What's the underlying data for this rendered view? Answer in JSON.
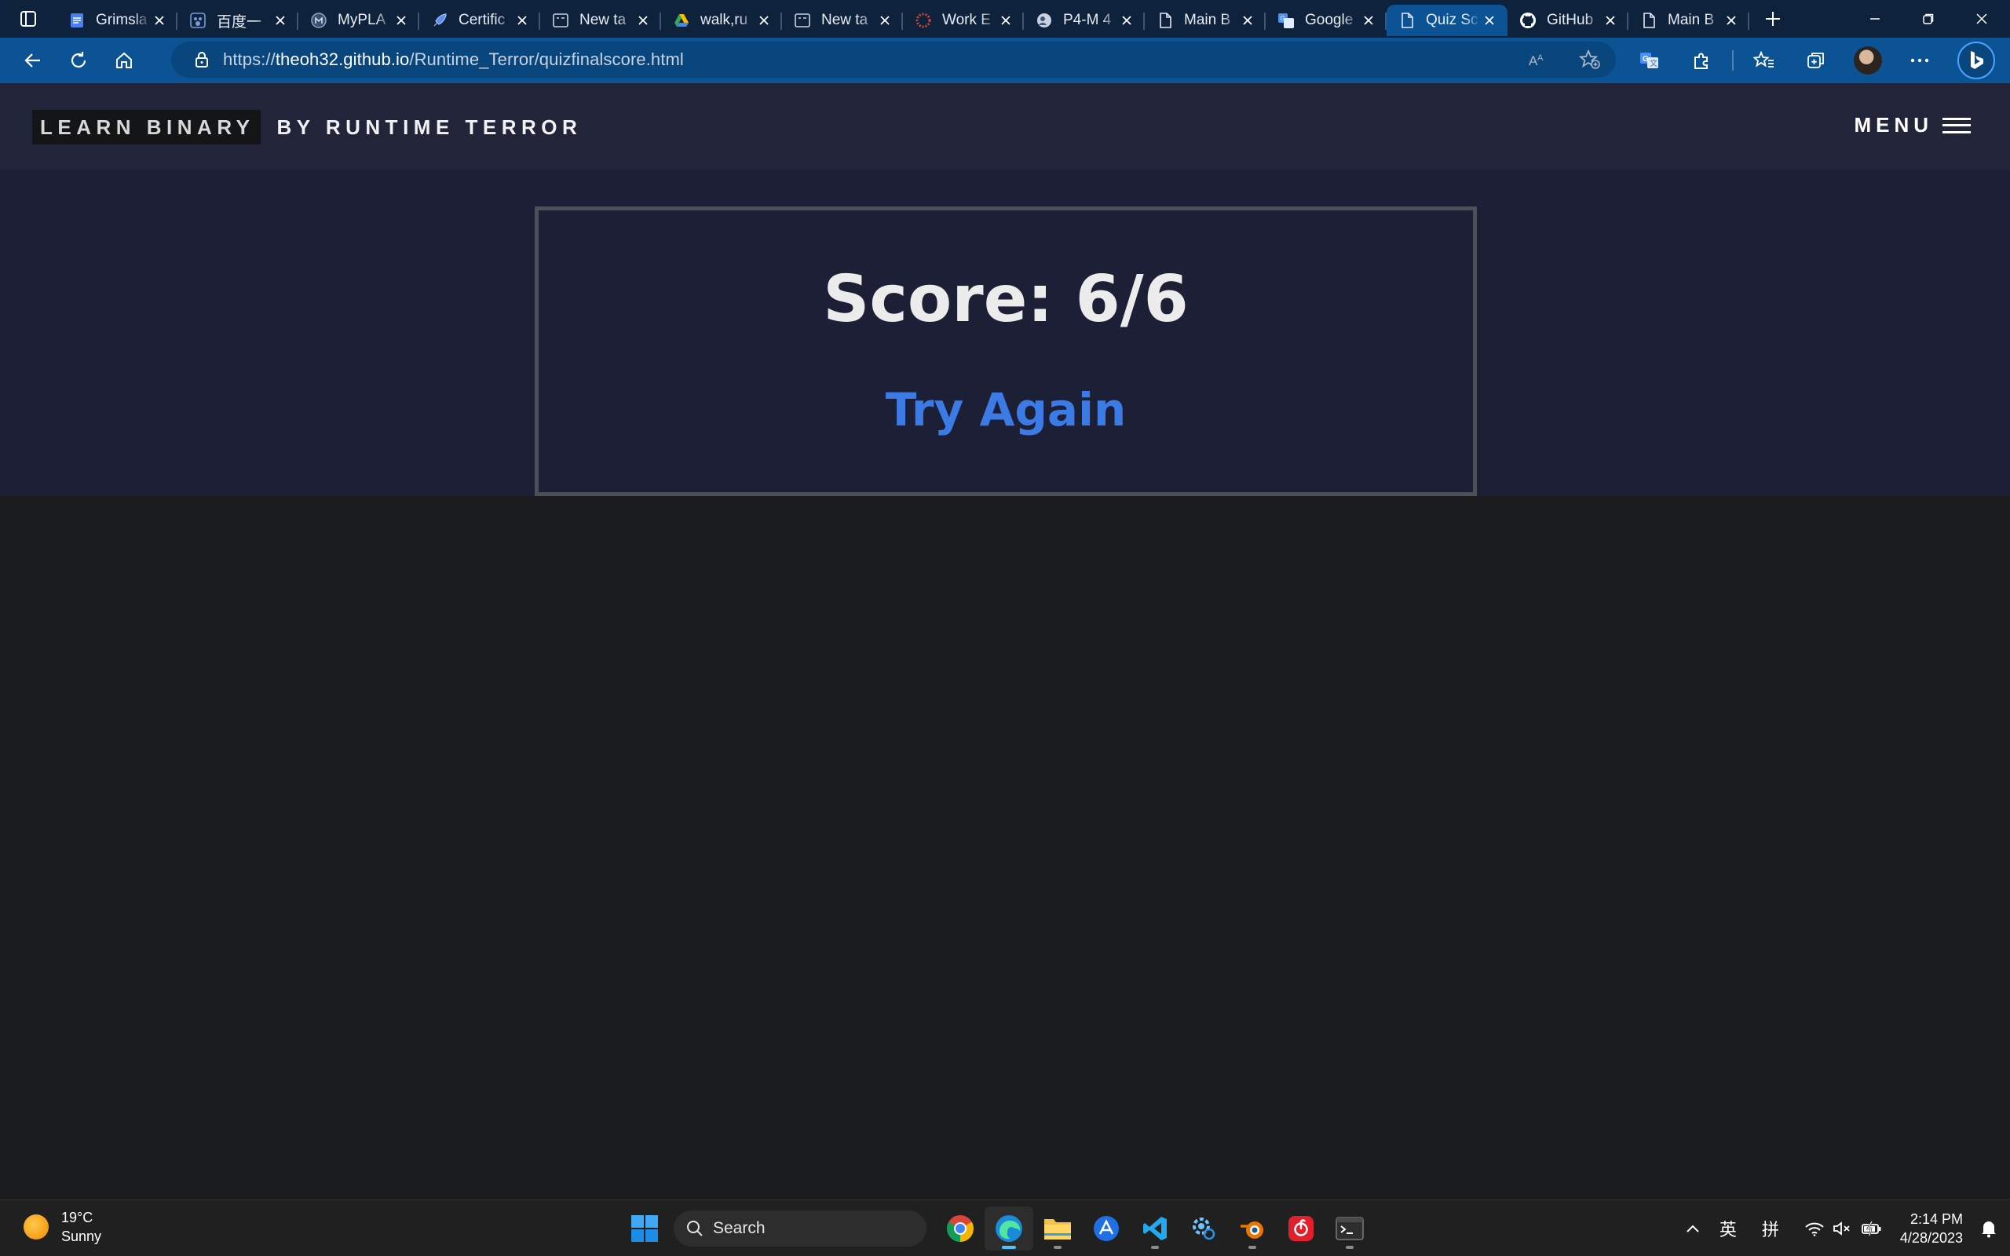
{
  "browser": {
    "tabs": [
      {
        "title": "Grimsla",
        "icon": "docs-icon",
        "active": false
      },
      {
        "title": "百度一",
        "icon": "baidu-icon",
        "active": false
      },
      {
        "title": "MyPLA",
        "icon": "myplan-icon",
        "active": false
      },
      {
        "title": "Certific",
        "icon": "rocket-icon",
        "active": false
      },
      {
        "title": "New ta",
        "icon": "newtab-page-icon",
        "active": false
      },
      {
        "title": "walk,ru",
        "icon": "drive-icon",
        "active": false
      },
      {
        "title": "New ta",
        "icon": "newtab-page-icon",
        "active": false
      },
      {
        "title": "Work E",
        "icon": "dots-ring-icon",
        "active": false
      },
      {
        "title": "P4-M 4",
        "icon": "globe-user-icon",
        "active": false
      },
      {
        "title": "Main B",
        "icon": "document-icon",
        "active": false
      },
      {
        "title": "Google",
        "icon": "google-translate-icon",
        "active": false
      },
      {
        "title": "Quiz Sc",
        "icon": "document-icon",
        "active": true
      },
      {
        "title": "GitHub",
        "icon": "github-icon",
        "active": false
      },
      {
        "title": "Main B",
        "icon": "document-icon",
        "active": false
      }
    ],
    "url_prefix": "https://",
    "url_host": "theoh32.github.io",
    "url_path": "/Runtime_Terror/quizfinalscore.html"
  },
  "site": {
    "brand_box": "LEARN BINARY",
    "brand_by": "BY RUNTIME TERROR",
    "menu_label": "MENU"
  },
  "quiz": {
    "score_text": "Score: 6/6",
    "try_again_label": "Try Again"
  },
  "taskbar": {
    "weather_temp": "19°C",
    "weather_desc": "Sunny",
    "search_placeholder": "Search",
    "ime_lang": "英",
    "ime_mode": "拼",
    "time": "2:14 PM",
    "date": "4/28/2023"
  },
  "colors": {
    "tab_strip": "#0f223c",
    "active_tab": "#0b5394",
    "site_header": "#22243a",
    "score_band": "#1d1f36",
    "score_border": "#4c5158",
    "try_again": "#3c7be6",
    "page_bg": "#1b1c1d"
  }
}
